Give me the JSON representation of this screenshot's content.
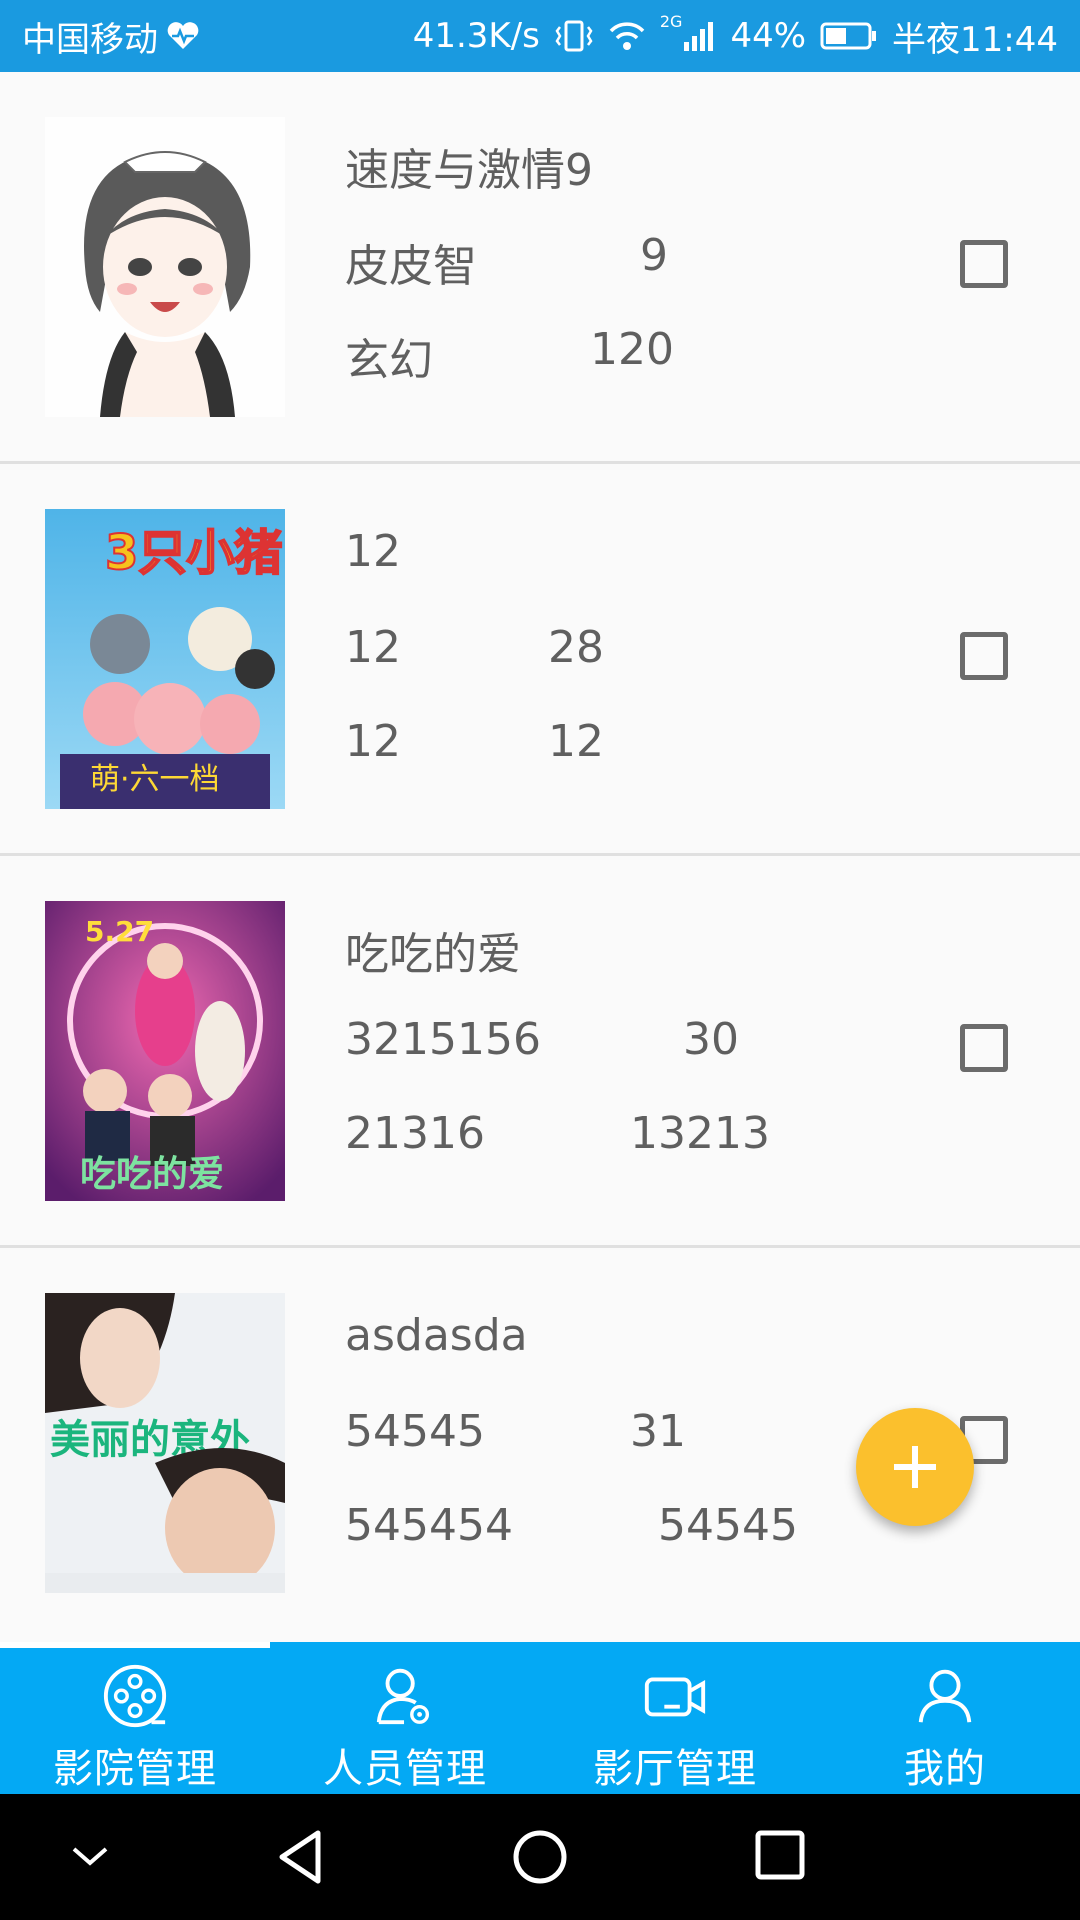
{
  "status_bar": {
    "carrier": "中国移动",
    "speed": "41.3K/s",
    "network": "2G",
    "battery": "44%",
    "time": "半夜11:44"
  },
  "items": [
    {
      "title": "速度与激情9",
      "row2_a": "皮皮智",
      "row2_b": "9",
      "row3_a": "玄幻",
      "row3_b": "120",
      "poster": "anime-girl-image"
    },
    {
      "title": "12",
      "row2_a": "12",
      "row2_b": "28",
      "row3_a": "12",
      "row3_b": "12",
      "poster": "cartoon-pigs-poster"
    },
    {
      "title": "吃吃的爱",
      "row2_a": "3215156",
      "row2_b": "30",
      "row3_a": "21316",
      "row3_b": "13213",
      "poster": "movie-poster-pink"
    },
    {
      "title": "asdasda",
      "row2_a": "54545",
      "row2_b": "31",
      "row3_a": "545454",
      "row3_b": "54545",
      "poster": "movie-poster-couple"
    }
  ],
  "nav": [
    {
      "label": "影院管理",
      "icon": "film-reel-icon",
      "active": true
    },
    {
      "label": "人员管理",
      "icon": "user-settings-icon",
      "active": false
    },
    {
      "label": "影厅管理",
      "icon": "video-camera-icon",
      "active": false
    },
    {
      "label": "我的",
      "icon": "person-icon",
      "active": false
    }
  ],
  "colors": {
    "status_bar": "#1a9ae0",
    "nav_bar": "#04a9f4",
    "fab": "#fbc02d",
    "text": "#5f5f5f"
  }
}
